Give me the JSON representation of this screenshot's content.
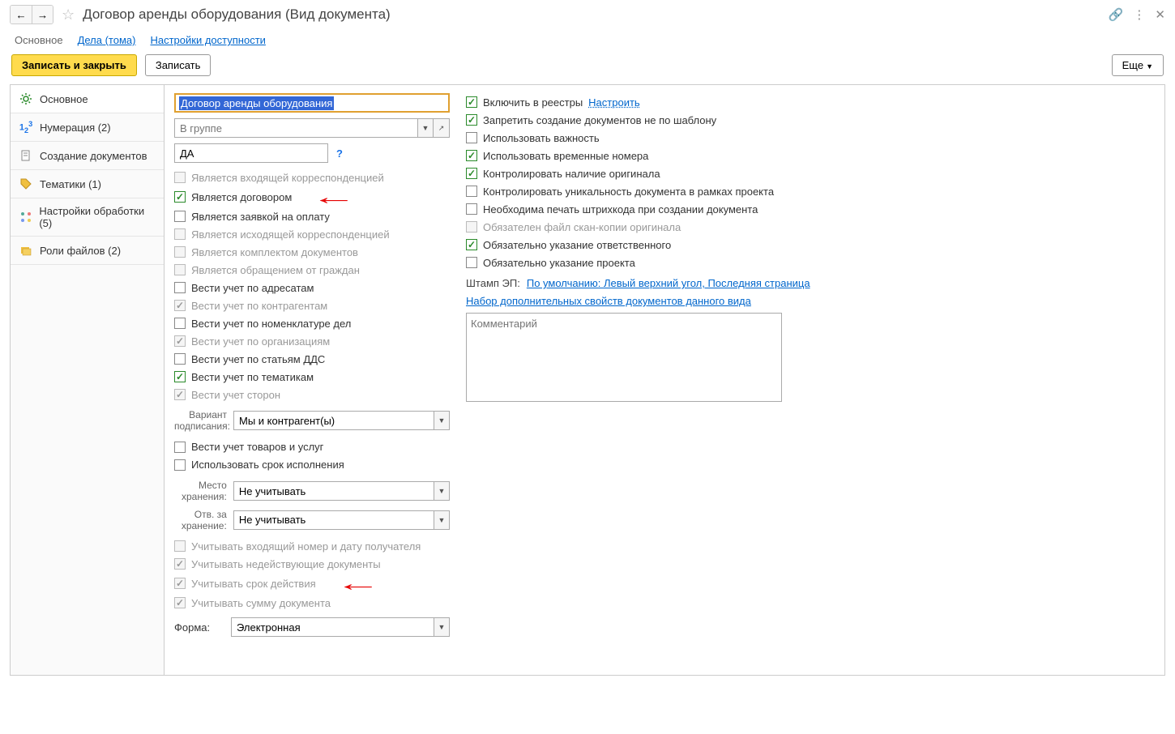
{
  "title": "Договор аренды оборудования (Вид документа)",
  "tabs": {
    "main": "Основное",
    "cases": "Дела (тома)",
    "access": "Настройки доступности"
  },
  "toolbar": {
    "save_close": "Записать и закрыть",
    "save": "Записать",
    "more": "Еще"
  },
  "sidebar": [
    {
      "label": "Основное",
      "icon": "gear"
    },
    {
      "label": "Нумерация (2)",
      "icon": "num"
    },
    {
      "label": "Создание документов",
      "icon": "doc"
    },
    {
      "label": "Тематики (1)",
      "icon": "tag"
    },
    {
      "label": "Настройки обработки (5)",
      "icon": "flow"
    },
    {
      "label": "Роли файлов (2)",
      "icon": "roles"
    }
  ],
  "left": {
    "name_value": "Договор аренды оборудования",
    "group_placeholder": "В группе",
    "code_value": "ДА",
    "checks": [
      {
        "label": "Является входящей корреспонденцией",
        "checked": false,
        "disabled": true
      },
      {
        "label": "Является договором",
        "checked": true,
        "disabled": false,
        "arrow": true
      },
      {
        "label": "Является заявкой на оплату",
        "checked": false,
        "disabled": false
      },
      {
        "label": "Является исходящей корреспонденцией",
        "checked": false,
        "disabled": true
      },
      {
        "label": "Является комплектом документов",
        "checked": false,
        "disabled": true
      },
      {
        "label": "Является обращением от граждан",
        "checked": false,
        "disabled": true
      },
      {
        "label": "Вести учет по адресатам",
        "checked": false,
        "disabled": false
      },
      {
        "label": "Вести учет по контрагентам",
        "checked": true,
        "disabled": true
      },
      {
        "label": "Вести учет по номенклатуре дел",
        "checked": false,
        "disabled": false
      },
      {
        "label": "Вести учет по организациям",
        "checked": true,
        "disabled": true
      },
      {
        "label": "Вести учет по статьям ДДС",
        "checked": false,
        "disabled": false
      },
      {
        "label": "Вести учет по тематикам",
        "checked": true,
        "disabled": false
      },
      {
        "label": "Вести учет сторон",
        "checked": true,
        "disabled": true
      }
    ],
    "sign_label": "Вариант подписания:",
    "sign_value": "Мы и контрагент(ы)",
    "checks2": [
      {
        "label": "Вести учет товаров и услуг",
        "checked": false,
        "disabled": false
      },
      {
        "label": "Использовать срок исполнения",
        "checked": false,
        "disabled": false
      }
    ],
    "storage_label": "Место хранения:",
    "storage_value": "Не учитывать",
    "resp_label": "Отв. за хранение:",
    "resp_value": "Не учитывать",
    "checks3": [
      {
        "label": "Учитывать входящий номер и дату получателя",
        "checked": false,
        "disabled": true
      },
      {
        "label": "Учитывать недействующие документы",
        "checked": true,
        "disabled": true
      },
      {
        "label": "Учитывать срок действия",
        "checked": true,
        "disabled": true,
        "arrow": true
      },
      {
        "label": "Учитывать сумму документа",
        "checked": true,
        "disabled": true
      }
    ],
    "form_label": "Форма:",
    "form_value": "Электронная"
  },
  "right": {
    "checks": [
      {
        "label": "Включить в реестры",
        "checked": true,
        "link": "Настроить"
      },
      {
        "label": "Запретить создание документов не по шаблону",
        "checked": true
      },
      {
        "label": "Использовать важность",
        "checked": false
      },
      {
        "label": "Использовать временные номера",
        "checked": true
      },
      {
        "label": "Контролировать наличие оригинала",
        "checked": true
      },
      {
        "label": "Контролировать уникальность документа в рамках проекта",
        "checked": false
      },
      {
        "label": "Необходима печать штрихкода при создании документа",
        "checked": false
      },
      {
        "label": "Обязателен файл скан-копии оригинала",
        "checked": false,
        "disabled": true
      },
      {
        "label": "Обязательно указание ответственного",
        "checked": true
      },
      {
        "label": "Обязательно указание проекта",
        "checked": false
      }
    ],
    "stamp_label": "Штамп ЭП:",
    "stamp_link": "По умолчанию: Левый верхний угол, Последняя страница",
    "props_link": "Набор дополнительных свойств документов данного вида",
    "comment_placeholder": "Комментарий"
  }
}
